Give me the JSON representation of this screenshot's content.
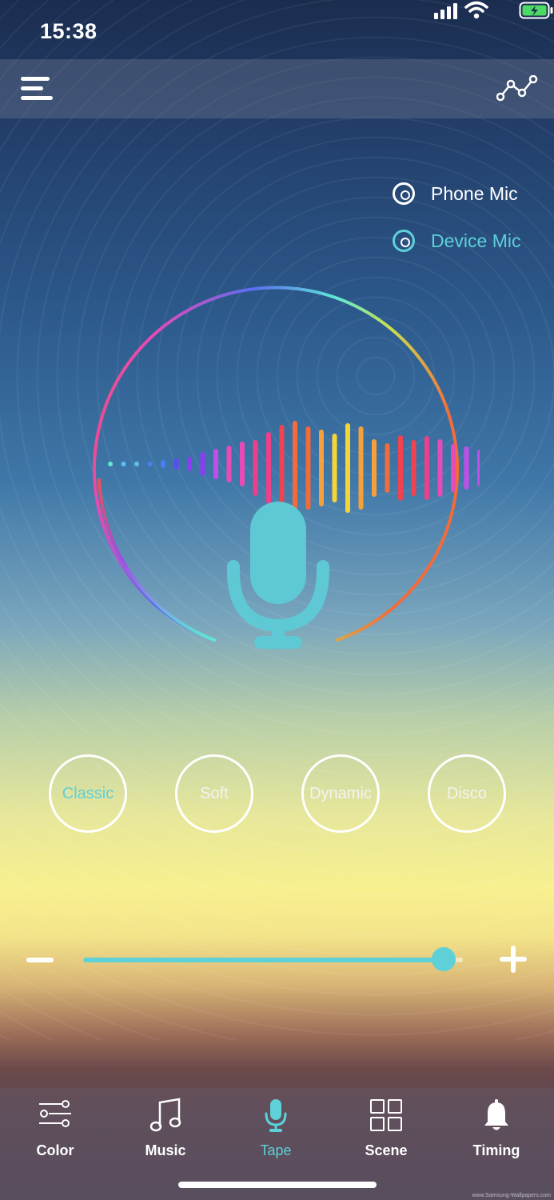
{
  "status_bar": {
    "time": "15:38",
    "icons": [
      "signal-icon",
      "wifi-icon",
      "battery-charging-icon"
    ],
    "battery_color": "#4cd964"
  },
  "header": {
    "left_icon": "menu-icon",
    "right_icon": "line-graph-icon"
  },
  "mic_source": {
    "options": [
      {
        "label": "Phone Mic",
        "selected": false
      },
      {
        "label": "Device Mic",
        "selected": true
      }
    ],
    "selected_color": "#5ed0d8"
  },
  "visualizer": {
    "icon": "microphone-icon",
    "ring_colors": [
      "#ef5350",
      "#e84ab6",
      "#5b6df0",
      "#5ee8d4",
      "#8be04e",
      "#f5d43a",
      "#f26b3a"
    ],
    "bars": [
      4,
      4,
      4,
      6,
      10,
      14,
      18,
      30,
      38,
      46,
      56,
      70,
      90,
      108,
      118,
      104,
      96,
      86,
      112,
      104,
      72,
      62,
      82,
      70,
      80,
      72,
      60,
      54,
      46,
      36
    ]
  },
  "modes": {
    "items": [
      {
        "label": "Classic",
        "active": true
      },
      {
        "label": "Soft",
        "active": false
      },
      {
        "label": "Dynamic",
        "active": false
      },
      {
        "label": "Disco",
        "active": false
      }
    ]
  },
  "sensitivity_slider": {
    "value_fraction": 0.95,
    "decrease_icon": "minus-icon",
    "increase_icon": "plus-icon",
    "accent_color": "#5ed0d8"
  },
  "tabbar": {
    "tabs": [
      {
        "label": "Color",
        "icon": "sliders-icon",
        "active": false
      },
      {
        "label": "Music",
        "icon": "music-note-icon",
        "active": false
      },
      {
        "label": "Tape",
        "icon": "microphone-icon",
        "active": true
      },
      {
        "label": "Scene",
        "icon": "grid-icon",
        "active": false
      },
      {
        "label": "Timing",
        "icon": "bell-icon",
        "active": false
      }
    ]
  },
  "watermark": "www.Samsung-Wallpapers.com"
}
